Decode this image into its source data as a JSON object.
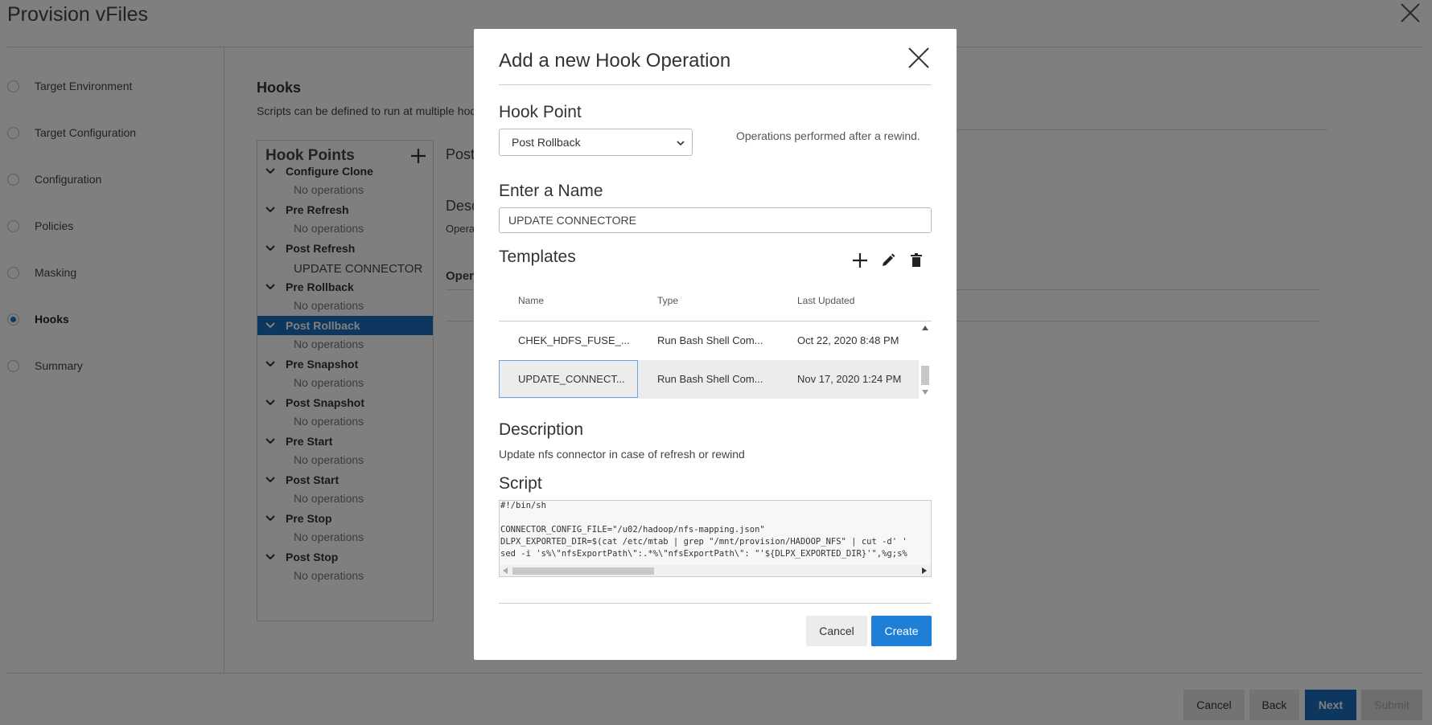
{
  "page": {
    "title": "Provision vFiles",
    "steps": [
      {
        "label": "Target Environment",
        "active": false
      },
      {
        "label": "Target Configuration",
        "active": false
      },
      {
        "label": "Configuration",
        "active": false
      },
      {
        "label": "Policies",
        "active": false
      },
      {
        "label": "Masking",
        "active": false
      },
      {
        "label": "Hooks",
        "active": true
      },
      {
        "label": "Summary",
        "active": false
      }
    ],
    "hooks_title": "Hooks",
    "hooks_subtitle": "Scripts can be defined to run at multiple hoo",
    "hook_points_title": "Hook Points",
    "hook_points": [
      {
        "label": "Configure Clone",
        "sub": "No operations",
        "selected": false
      },
      {
        "label": "Pre Refresh",
        "sub": "No operations",
        "selected": false
      },
      {
        "label": "Post Refresh",
        "sub": "UPDATE CONNECTOR",
        "selected": false
      },
      {
        "label": "Pre Rollback",
        "sub": "No operations",
        "selected": false
      },
      {
        "label": "Post Rollback",
        "sub": "No operations",
        "selected": true
      },
      {
        "label": "Pre Snapshot",
        "sub": "No operations",
        "selected": false
      },
      {
        "label": "Post Snapshot",
        "sub": "No operations",
        "selected": false
      },
      {
        "label": "Pre Start",
        "sub": "No operations",
        "selected": false
      },
      {
        "label": "Post Start",
        "sub": "No operations",
        "selected": false
      },
      {
        "label": "Pre Stop",
        "sub": "No operations",
        "selected": false
      },
      {
        "label": "Post Stop",
        "sub": "No operations",
        "selected": false
      }
    ],
    "right_partial": {
      "heading": "Post",
      "desc_label": "Desc",
      "desc_text": "Opera",
      "ops_label": "Oper"
    },
    "footer": {
      "cancel": "Cancel",
      "back": "Back",
      "next": "Next",
      "submit": "Submit"
    }
  },
  "modal": {
    "title": "Add a new Hook Operation",
    "hook_point_label": "Hook Point",
    "hook_point_value": "Post Rollback",
    "hook_point_hint": "Operations performed after a rewind.",
    "name_label": "Enter a Name",
    "name_value": "UPDATE CONNECTORE",
    "templates_label": "Templates",
    "templates_columns": [
      "Name",
      "Type",
      "Last Updated"
    ],
    "templates_rows": [
      {
        "name": "CHEK_HDFS_FUSE_...",
        "type": "Run Bash Shell Com...",
        "updated": "Oct 22, 2020 8:48 PM",
        "selected": false
      },
      {
        "name": "UPDATE_CONNECT...",
        "type": "Run Bash Shell Com...",
        "updated": "Nov 17, 2020 1:24 PM",
        "selected": true
      }
    ],
    "description_label": "Description",
    "description_text": "Update nfs connector in case of refresh or rewind",
    "script_label": "Script",
    "script_lines": [
      "#!/bin/sh",
      "",
      "CONNECTOR_CONFIG_FILE=\"/u02/hadoop/nfs-mapping.json\"",
      "DLPX_EXPORTED_DIR=$(cat /etc/mtab | grep \"/mnt/provision/HADOOP_NFS\" | cut -d' '",
      "sed -i 's%\\\"nfsExportPath\\\":.*%\\\"nfsExportPath\\\": \"'${DLPX_EXPORTED_DIR}'\",%g;s%"
    ],
    "cancel_label": "Cancel",
    "create_label": "Create"
  },
  "colors": {
    "accent": "#1d6fbf",
    "create_button": "#1d7fd6",
    "overlay": "rgba(0,0,0,0.5)"
  }
}
